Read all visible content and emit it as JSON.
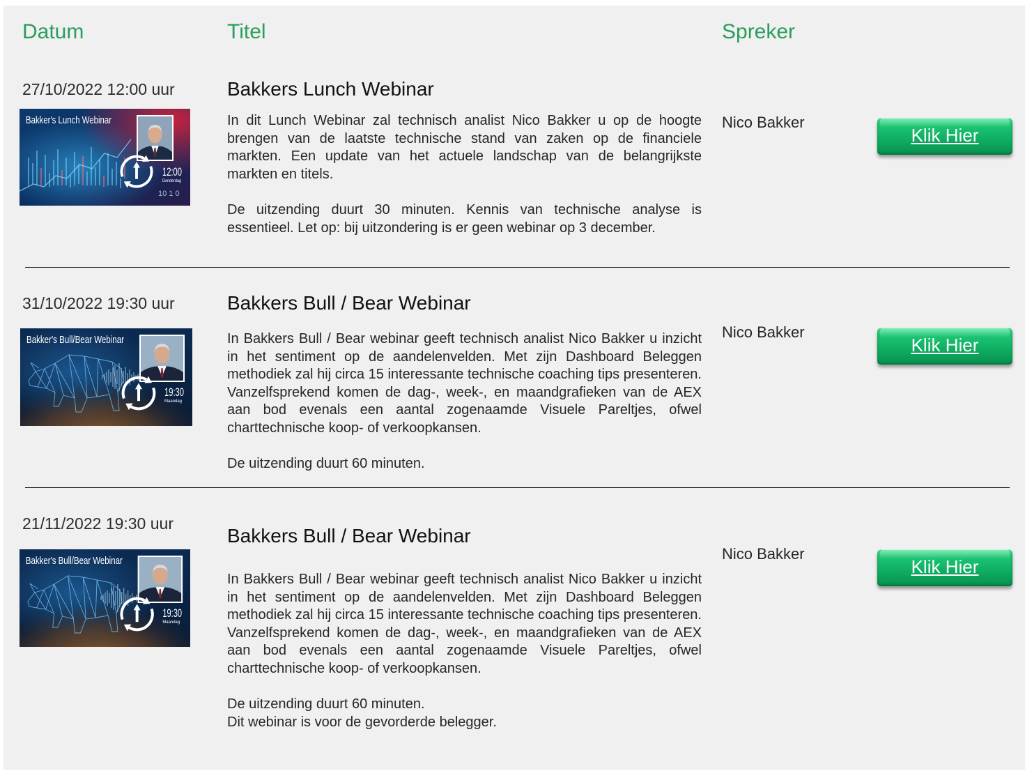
{
  "header": {
    "date_label": "Datum",
    "title_label": "Titel",
    "speaker_label": "Spreker"
  },
  "webinars": [
    {
      "date": "27/10/2022 12:00 uur",
      "title": "Bakkers Lunch Webinar",
      "description": [
        "In dit Lunch Webinar zal technisch analist Nico Bakker u op de hoogte brengen van de laatste technische stand van zaken op de financiele markten. Een update van het actuele landschap van de belangrijkste markten en titels.",
        "De uitzending duurt 30 minuten. Kennis van technische analyse is essentieel. Let op: bij uitzondering is er geen webinar op 3 december."
      ],
      "speaker": "Nico Bakker",
      "button_label": "Klik Hier",
      "thumbnail": {
        "caption": "Bakker's Lunch Webinar",
        "time": "12:00",
        "day": "Donderdag",
        "background_digits": "10 1 0"
      }
    },
    {
      "date": "31/10/2022 19:30 uur",
      "title": "Bakkers Bull / Bear Webinar",
      "description": [
        "In Bakkers Bull / Bear webinar geeft technisch analist Nico Bakker u inzicht in het sentiment op de aandelenvelden. Met zijn Dashboard Beleggen methodiek zal hij circa 15 interessante technische coaching tips presenteren. Vanzelfsprekend komen de dag-, week-, en maandgrafieken van de AEX aan bod evenals een aantal zogenaamde Visuele Pareltjes, ofwel charttechnische koop- of verkoopkansen.",
        "De uitzending duurt 60 minuten."
      ],
      "speaker": "Nico Bakker",
      "button_label": "Klik Hier",
      "thumbnail": {
        "caption": "Bakker's Bull/Bear Webinar",
        "time": "19:30",
        "day": "Maandag"
      }
    },
    {
      "date": "21/11/2022 19:30 uur",
      "title": "Bakkers Bull / Bear Webinar",
      "description": [
        "In Bakkers Bull / Bear webinar geeft technisch analist Nico Bakker u inzicht in het sentiment op de aandelenvelden. Met zijn Dashboard Beleggen methodiek zal hij circa 15 interessante technische coaching tips presenteren. Vanzelfsprekend komen de dag-, week-, en maandgrafieken van de AEX aan bod evenals een aantal zogenaamde Visuele Pareltjes, ofwel charttechnische koop- of verkoopkansen.",
        "De uitzending duurt 60 minuten.",
        "Dit webinar is voor de gevorderde belegger."
      ],
      "speaker": "Nico Bakker",
      "button_label": "Klik Hier",
      "thumbnail": {
        "caption": "Bakker's Bull/Bear Webinar",
        "time": "19:30",
        "day": "Maandag"
      }
    }
  ],
  "colors": {
    "accent_green": "#2a9d5c",
    "button_top": "#3fe08f",
    "button_bottom": "#07914f",
    "divider": "#1a1a1a",
    "panel_background": "#f0f0f0"
  },
  "icons": [
    "refresh-clock-icon",
    "speaker-portrait",
    "bull-wireframe"
  ]
}
